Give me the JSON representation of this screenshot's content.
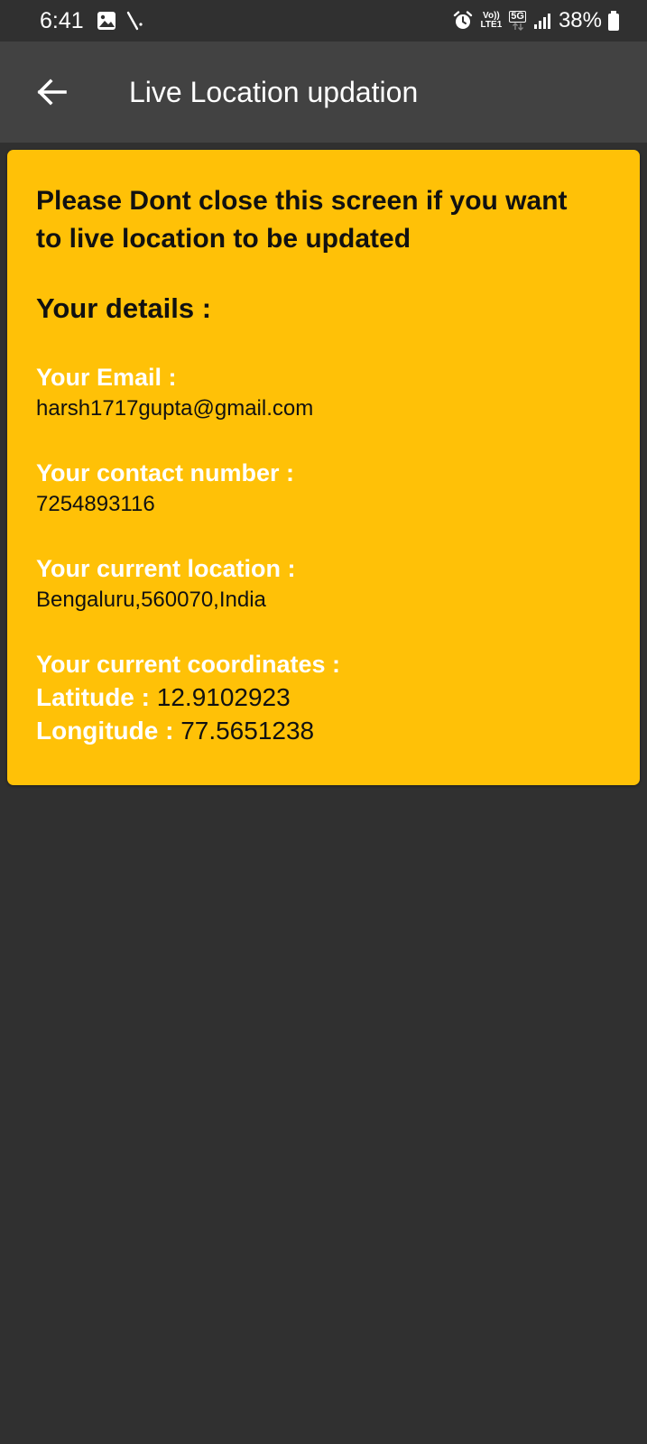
{
  "status_bar": {
    "time": "6:41",
    "network_top": "Vo))",
    "network_bottom": "LTE1",
    "network_5g": "5G",
    "battery": "38%"
  },
  "app_bar": {
    "title": "Live Location updation"
  },
  "card": {
    "warning": "Please Dont close this screen if you want to live location to be updated",
    "details_heading": "Your details :",
    "email_label": "Your Email :",
    "email_value": "harsh1717gupta@gmail.com",
    "contact_label": "Your contact number :",
    "contact_value": "7254893116",
    "location_label": "Your current location :",
    "location_value": "Bengaluru,560070,India",
    "coordinates_label": "Your current coordinates :",
    "latitude_label": "Latitude : ",
    "latitude_value": "12.9102923",
    "longitude_label": "Longitude : ",
    "longitude_value": "77.5651238"
  },
  "colors": {
    "background": "#303030",
    "app_bar": "#424242",
    "card": "#FFC107"
  }
}
